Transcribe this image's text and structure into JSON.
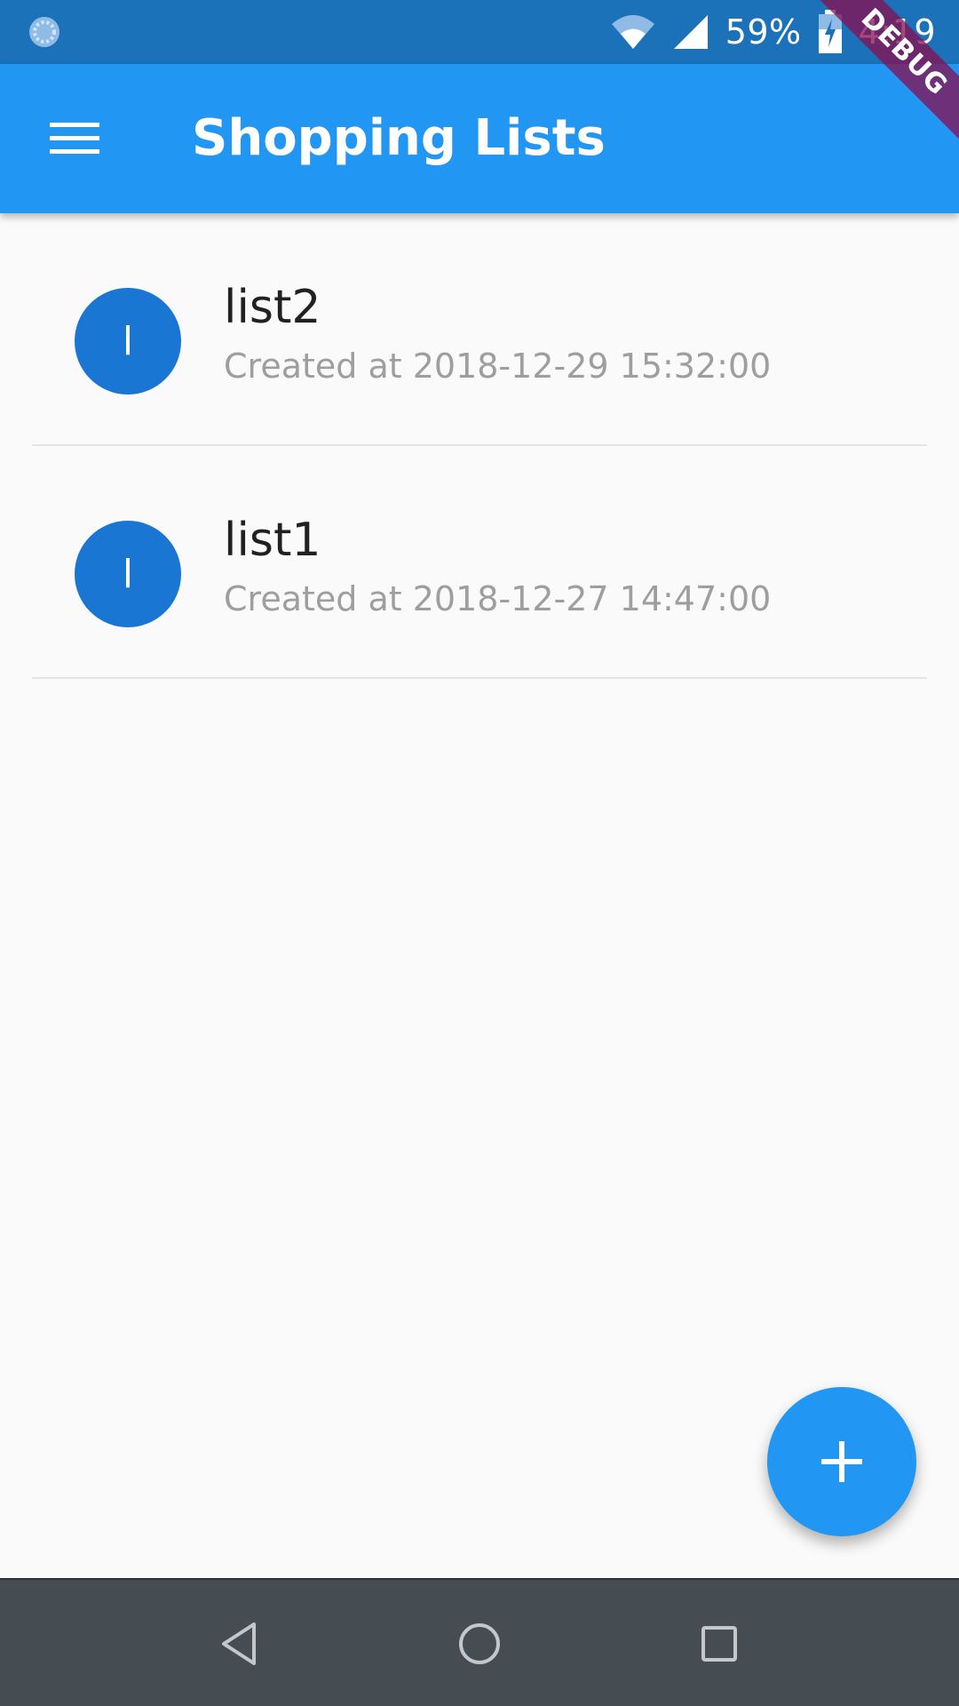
{
  "status_bar": {
    "battery": "59%",
    "time": "4:19"
  },
  "debug_banner": "DEBUG",
  "app_bar": {
    "title": "Shopping Lists",
    "menu_icon": "menu-icon"
  },
  "lists": [
    {
      "avatar_letter": "l",
      "name": "list2",
      "subtitle": "Created at 2018-12-29 15:32:00"
    },
    {
      "avatar_letter": "l",
      "name": "list1",
      "subtitle": "Created at 2018-12-27 14:47:00"
    }
  ],
  "fab": {
    "icon": "plus-icon"
  },
  "nav_bar": {
    "back_icon": "back-icon",
    "home_icon": "home-icon",
    "recents_icon": "recents-icon"
  },
  "colors": {
    "status_bar": "#1b72b9",
    "app_bar": "#2196f3",
    "avatar": "#1976d2",
    "fab": "#2196f3",
    "nav_bar": "#454c52",
    "background": "#fafafa"
  }
}
